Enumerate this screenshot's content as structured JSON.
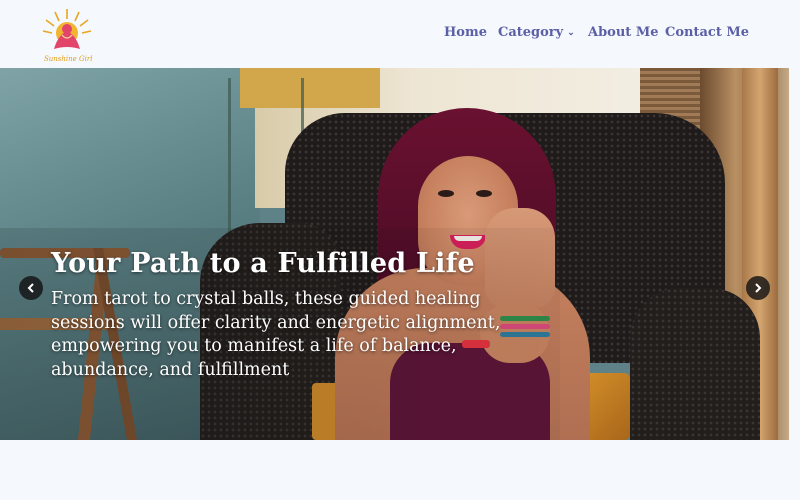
{
  "brand": {
    "logo_text": "Sunshine Girl",
    "accent": "#5b5fa6",
    "logo_colors": [
      "#e0a020",
      "#e2456a"
    ]
  },
  "nav": {
    "items": [
      {
        "label": "Home"
      },
      {
        "label": "Category",
        "has_dropdown": true
      },
      {
        "label": "About Me"
      },
      {
        "label": "Contact Me"
      }
    ]
  },
  "hero": {
    "title": "Your Path to a Fulfilled Life",
    "description_lines": [
      "From tarot to crystal balls, these guided healing",
      "sessions will offer clarity and energetic alignment,",
      "empowering you to manifest a life of balance,",
      "abundance, and fulfillment"
    ],
    "prev_icon": "chevron-left-icon",
    "next_icon": "chevron-right-icon"
  }
}
